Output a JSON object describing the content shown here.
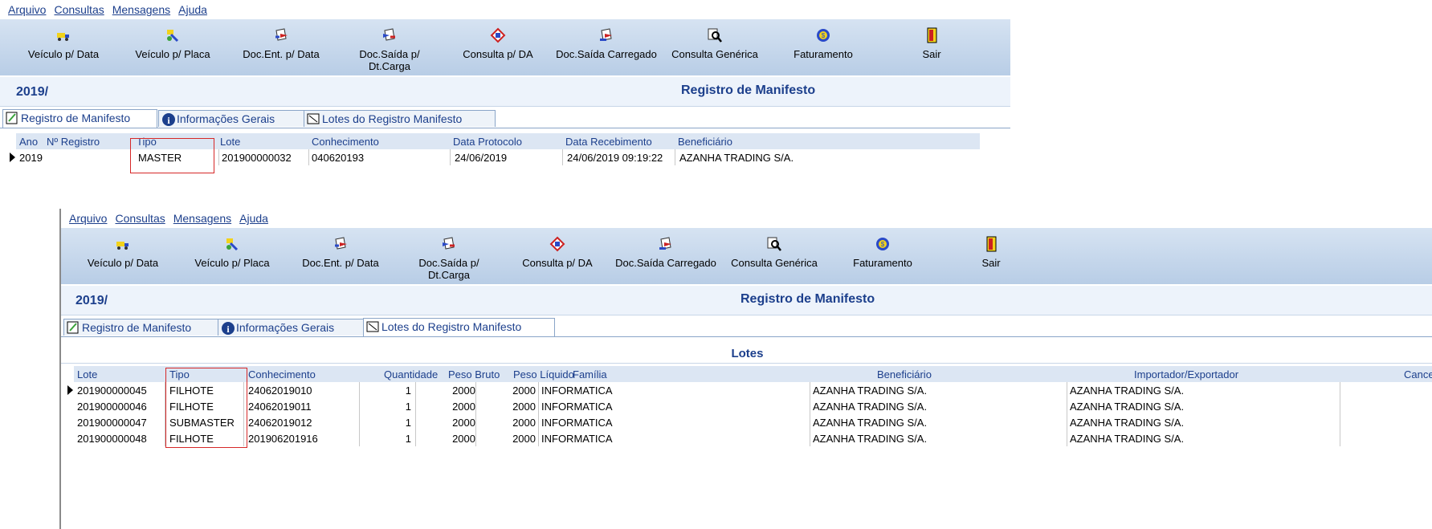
{
  "menu": [
    "Arquivo",
    "Consultas",
    "Mensagens",
    "Ajuda"
  ],
  "toolbar": [
    {
      "label": "Veículo p/ Data",
      "icon": "truck-icon"
    },
    {
      "label": "Veículo p/ Placa",
      "icon": "plate-icon"
    },
    {
      "label": "Doc.Ent. p/ Data",
      "icon": "doc-in-icon"
    },
    {
      "label": "Doc.Saída p/ Dt.Carga",
      "icon": "doc-out-icon"
    },
    {
      "label": "Consulta p/ DA",
      "icon": "consulta-da-icon"
    },
    {
      "label": "Doc.Saída Carregado",
      "icon": "doc-loaded-icon"
    },
    {
      "label": "Consulta Genérica",
      "icon": "magnifier-icon"
    },
    {
      "label": "Faturamento",
      "icon": "money-icon"
    },
    {
      "label": "Sair",
      "icon": "exit-door-icon"
    }
  ],
  "header": {
    "year": "2019/",
    "title": "Registro de Manifesto"
  },
  "tabs": [
    "Registro de Manifesto",
    "Informações Gerais",
    "Lotes do Registro Manifesto"
  ],
  "window1": {
    "columns": [
      "Ano",
      "Nº Registro",
      "Tipo",
      "Lote",
      "Conhecimento",
      "Data Protocolo",
      "Data Recebimento",
      "Beneficiário"
    ],
    "row": [
      "2019",
      "",
      "MASTER",
      "201900000032",
      "040620193",
      "24/06/2019",
      "24/06/2019 09:19:22",
      "AZANHA TRADING S/A."
    ]
  },
  "window2": {
    "caption": "Lotes",
    "columns": [
      "Lote",
      "Tipo",
      "Conhecimento",
      "Quantidade",
      "Peso Bruto",
      "Peso Líquido",
      "Família",
      "Beneficiário",
      "Importador/Exportador",
      "Cance"
    ],
    "rows": [
      [
        "201900000045",
        "FILHOTE",
        "24062019010",
        "1",
        "2000",
        "2000",
        "INFORMATICA",
        "AZANHA TRADING S/A.",
        "AZANHA TRADING S/A."
      ],
      [
        "201900000046",
        "FILHOTE",
        "24062019011",
        "1",
        "2000",
        "2000",
        "INFORMATICA",
        "AZANHA TRADING S/A.",
        "AZANHA TRADING S/A."
      ],
      [
        "201900000047",
        "SUBMASTER",
        "24062019012",
        "1",
        "2000",
        "2000",
        "INFORMATICA",
        "AZANHA TRADING S/A.",
        "AZANHA TRADING S/A."
      ],
      [
        "201900000048",
        "FILHOTE",
        "201906201916",
        "1",
        "2000",
        "2000",
        "INFORMATICA",
        "AZANHA TRADING S/A.",
        "AZANHA TRADING S/A."
      ]
    ]
  },
  "colors": {
    "accent": "#1c3f8c",
    "highlight_box": "#d62828",
    "toolbar": "#c8d9ee"
  }
}
